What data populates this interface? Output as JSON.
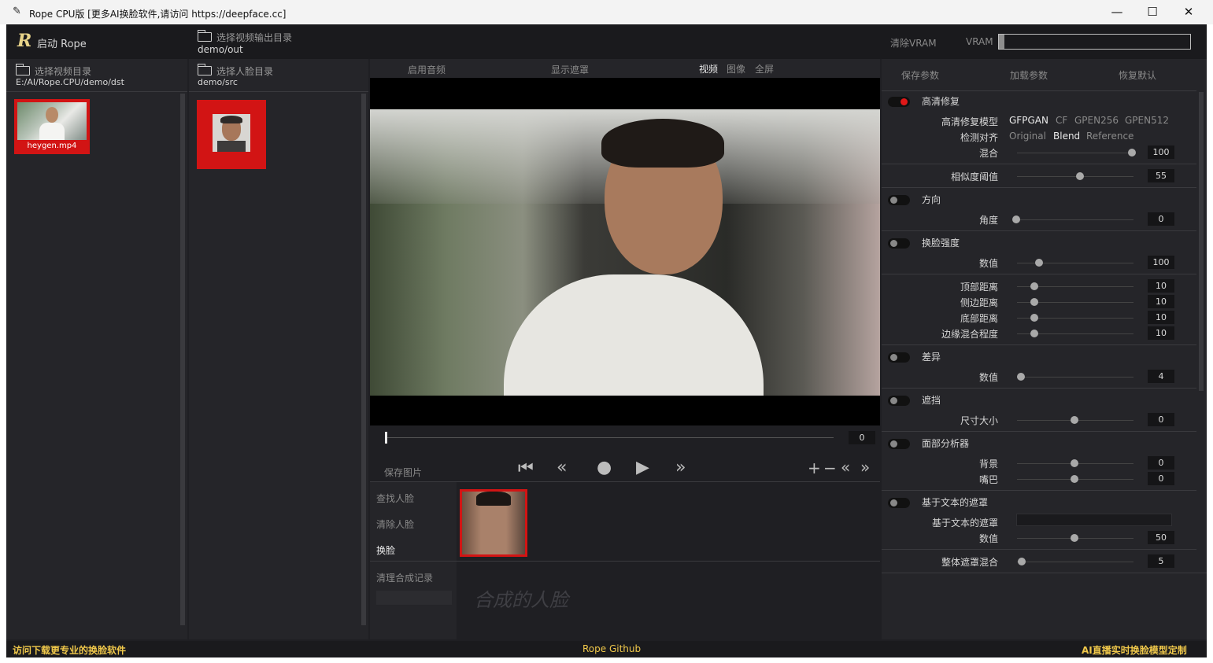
{
  "window": {
    "title": "Rope CPU版 [更多AI换脸软件,请访问 https://deepface.cc]",
    "minimize": "—",
    "maximize": "☐",
    "close": "✕"
  },
  "topbar": {
    "logo": "R",
    "start_label": "启动 Rope",
    "output_dir_label": "选择视频输出目录",
    "output_dir_path": "demo/out",
    "clear_vram": "清除VRAM",
    "vram_label": "VRAM",
    "vram_usage": 0.03
  },
  "video_panel": {
    "dir_label": "选择视频目录",
    "dir_path": "E:/AI/Rope.CPU/demo/dst",
    "items": [
      {
        "name": "heygen.mp4",
        "selected": true
      }
    ]
  },
  "face_panel": {
    "dir_label": "选择人脸目录",
    "dir_path": "demo/src"
  },
  "preview": {
    "tab_audio": "启用音频",
    "tab_mask": "显示遮罩",
    "mode_video": "视频",
    "mode_image": "图像",
    "mode_fullscreen": "全屏",
    "frame": "0",
    "save_image": "保存图片"
  },
  "face_ops": {
    "find": "查找人脸",
    "clear": "清除人脸",
    "swap": "换脸",
    "clear_history": "清理合成记录",
    "merged_placeholder": "合成的人脸"
  },
  "params": {
    "save": "保存参数",
    "load": "加载参数",
    "reset": "恢复默认",
    "hd_restore": "高清修复",
    "hd_model_label": "高清修复模型",
    "hd_models": [
      "GFPGAN",
      "CF",
      "GPEN256",
      "GPEN512"
    ],
    "align_label": "检测对齐",
    "align_options": [
      "Original",
      "Blend",
      "Reference"
    ],
    "blend_label": "混合",
    "blend_value": "100",
    "similarity_label": "相似度阈值",
    "similarity_value": "55",
    "orientation": "方向",
    "angle_label": "角度",
    "angle_value": "0",
    "strength": "换脸强度",
    "strength_value_label": "数值",
    "strength_value": "100",
    "top_label": "顶部距离",
    "top_value": "10",
    "side_label": "侧边距离",
    "side_value": "10",
    "bottom_label": "底部距离",
    "bottom_value": "10",
    "edge_label": "边缘混合程度",
    "edge_value": "10",
    "diff": "差异",
    "diff_value_label": "数值",
    "diff_value": "4",
    "occlusion": "遮挡",
    "size_label": "尺寸大小",
    "size_value": "0",
    "face_parser": "面部分析器",
    "bg_label": "背景",
    "bg_value": "0",
    "mouth_label": "嘴巴",
    "mouth_value": "0",
    "text_mask": "基于文本的遮罩",
    "text_mask_label": "基于文本的遮罩",
    "text_mask_value_label": "数值",
    "text_mask_value": "50",
    "overall_blend_label": "整体遮罩混合",
    "overall_blend_value": "5"
  },
  "footer": {
    "left": "访问下载更专业的换脸软件",
    "center": "Rope Github",
    "right": "AI直播实时换脸模型定制"
  }
}
